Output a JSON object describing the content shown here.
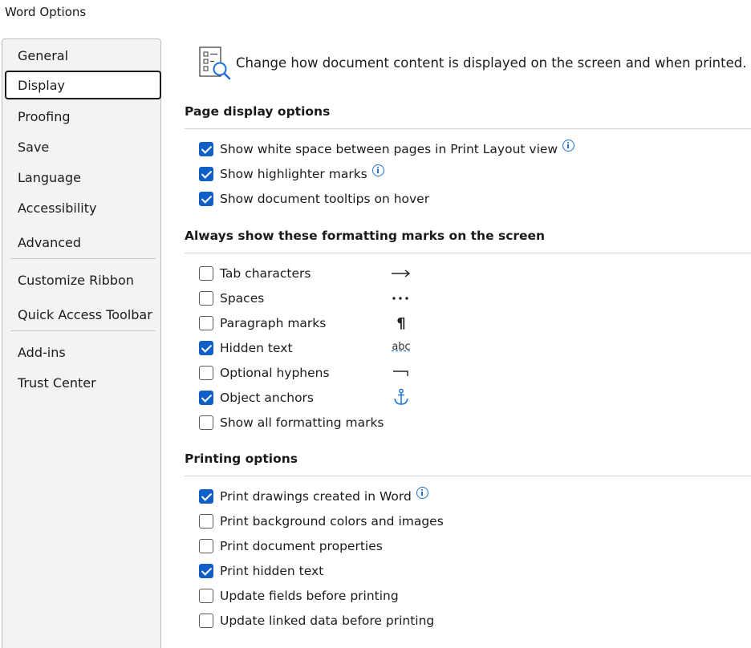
{
  "window": {
    "title": "Word Options"
  },
  "sidebar": {
    "items": [
      {
        "label": "General"
      },
      {
        "label": "Display",
        "selected": true
      },
      {
        "label": "Proofing"
      },
      {
        "label": "Save"
      },
      {
        "label": "Language"
      },
      {
        "label": "Accessibility"
      },
      {
        "label": "Advanced"
      },
      {
        "label": "Customize Ribbon"
      },
      {
        "label": "Quick Access Toolbar"
      },
      {
        "label": "Add-ins"
      },
      {
        "label": "Trust Center"
      }
    ]
  },
  "banner": {
    "icon": "display-options-icon",
    "text": "Change how document content is displayed on the screen and when printed."
  },
  "sections": {
    "page_display": {
      "title": "Page display options",
      "options": [
        {
          "label": "Show white space between pages in Print Layout view",
          "checked": true,
          "info": true
        },
        {
          "label": "Show highlighter marks",
          "checked": true,
          "info": true
        },
        {
          "label": "Show document tooltips on hover",
          "checked": true,
          "info": false
        }
      ]
    },
    "formatting_marks": {
      "title": "Always show these formatting marks on the screen",
      "options": [
        {
          "label": "Tab characters",
          "checked": false,
          "mark_icon": "tab-arrow-icon"
        },
        {
          "label": "Spaces",
          "checked": false,
          "mark_icon": "space-dots-icon"
        },
        {
          "label": "Paragraph marks",
          "checked": false,
          "mark_icon": "pilcrow-icon",
          "mark_text": "¶"
        },
        {
          "label": "Hidden text",
          "checked": true,
          "mark_icon": "hidden-text-icon",
          "mark_text": "abc"
        },
        {
          "label": "Optional hyphens",
          "checked": false,
          "mark_icon": "optional-hyphen-icon"
        },
        {
          "label": "Object anchors",
          "checked": true,
          "mark_icon": "anchor-icon"
        },
        {
          "label": "Show all formatting marks",
          "checked": false
        }
      ]
    },
    "printing": {
      "title": "Printing options",
      "options": [
        {
          "label": "Print drawings created in Word",
          "checked": true,
          "info": true
        },
        {
          "label": "Print background colors and images",
          "checked": false,
          "info": false
        },
        {
          "label": "Print document properties",
          "checked": false,
          "info": false
        },
        {
          "label": "Print hidden text",
          "checked": true,
          "info": false
        },
        {
          "label": "Update fields before printing",
          "checked": false,
          "info": false
        },
        {
          "label": "Update linked data before printing",
          "checked": false,
          "info": false
        }
      ]
    }
  },
  "colors": {
    "accent": "#0f5fc6",
    "info": "#1d6fd6",
    "sidebar_bg": "#f3f3f3"
  }
}
